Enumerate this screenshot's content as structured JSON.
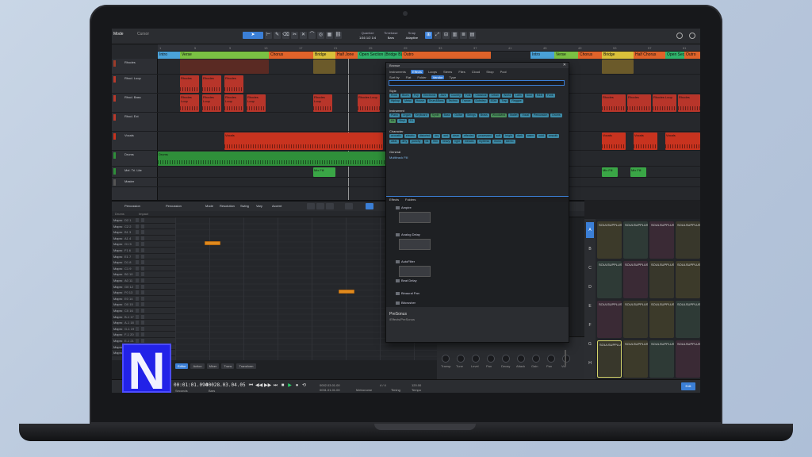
{
  "topbar": {
    "song": "Mode",
    "mode": "Cursor",
    "readouts": [
      {
        "label": "Quantize",
        "value": "1/16 1/2 1/4"
      },
      {
        "label": "Timebase",
        "value": "Bars"
      },
      {
        "label": "Snap",
        "value": "Adaptive"
      }
    ]
  },
  "ruler": [
    "1",
    "5",
    "9",
    "13",
    "17",
    "21",
    "25",
    "29",
    "33",
    "37",
    "41",
    "45",
    "49",
    "53",
    "57",
    "61"
  ],
  "markers": [
    {
      "label": "Intro",
      "color": "#4aa2d9"
    },
    {
      "label": "Verse",
      "color": "#7ac143"
    },
    {
      "label": "Chorus",
      "color": "#e0632a"
    },
    {
      "label": "Bridge",
      "color": "#d9c03a"
    },
    {
      "label": "Half Jone",
      "color": "#e0632a"
    },
    {
      "label": "Open Section (Bridge B)",
      "color": "#2fb36b"
    },
    {
      "label": "Outro",
      "color": "#e0632a"
    },
    {
      "label": "Intro",
      "color": "#4aa2d9"
    },
    {
      "label": "Verse",
      "color": "#7ac143"
    },
    {
      "label": "Chorus",
      "color": "#e0632a"
    },
    {
      "label": "Bridge",
      "color": "#d9c03a"
    },
    {
      "label": "Half Chorus",
      "color": "#e0632a"
    },
    {
      "label": "Open Sec. Ext",
      "color": "#2fb36b"
    },
    {
      "label": "Outro",
      "color": "#e0632a"
    }
  ],
  "tracks": [
    {
      "name": "Rhodes",
      "color": "#9b3b2a"
    },
    {
      "name": "Rhod. Loop",
      "color": "#b83a2c"
    },
    {
      "name": "Rhod. Bass",
      "color": "#b83a2c"
    },
    {
      "name": "Rhod. Ext",
      "color": "#b83a2c"
    },
    {
      "name": "Vocals",
      "color": "#c8331f"
    },
    {
      "name": "Drums",
      "color": "#2f8f3a"
    },
    {
      "name": "Mel. Tri. Lite",
      "color": "#2f8f3a"
    },
    {
      "name": "Master",
      "color": "#555"
    }
  ],
  "clip_labels": {
    "rhodes": "Rhodes",
    "rhodes_loop": "Rhodes Loop",
    "vocals": "Vocals",
    "drums": "Drums",
    "mix": "Mix Fill"
  },
  "editor": {
    "instrument": "Percussion",
    "preset": "Percussion",
    "controls": [
      "Mode",
      "Resolution",
      "Swing",
      "Vary",
      "Accent"
    ],
    "tabs": [
      "Editor",
      "Action",
      "Mixer",
      "Trans",
      "Transform"
    ],
    "sub_header": [
      "Drums",
      "Impact"
    ],
    "pitch_rows": [
      {
        "name": "Mapro",
        "pitch": "D2 1"
      },
      {
        "name": "Mapro",
        "pitch": "C2 2"
      },
      {
        "name": "Mapro",
        "pitch": "B1 3"
      },
      {
        "name": "Mapro",
        "pitch": "A1 4"
      },
      {
        "name": "Mapro",
        "pitch": "G1 5"
      },
      {
        "name": "Mapro",
        "pitch": "F1 6"
      },
      {
        "name": "Mapro",
        "pitch": "E1 7"
      },
      {
        "name": "Mapro",
        "pitch": "D1 8"
      },
      {
        "name": "Mapro",
        "pitch": "C1 9"
      },
      {
        "name": "Mapro",
        "pitch": "B0 10"
      },
      {
        "name": "Mapro",
        "pitch": "A0 11"
      },
      {
        "name": "Mapro",
        "pitch": "G0 12"
      },
      {
        "name": "Mapro",
        "pitch": "F0 13"
      },
      {
        "name": "Mapro",
        "pitch": "E0 14"
      },
      {
        "name": "Mapro",
        "pitch": "D0 15"
      },
      {
        "name": "Mapro",
        "pitch": "C0 16"
      },
      {
        "name": "Mapro",
        "pitch": "B-1 17"
      },
      {
        "name": "Mapro",
        "pitch": "A-1 18"
      },
      {
        "name": "Mapro",
        "pitch": "G-1 19"
      },
      {
        "name": "Mapro",
        "pitch": "F-1 20"
      },
      {
        "name": "Mapro",
        "pitch": "E-1 21"
      },
      {
        "name": "Mapro",
        "pitch": "D-1 22"
      },
      {
        "name": "Mapro",
        "pitch": "C-1 23"
      }
    ]
  },
  "browser": {
    "title": "Browse",
    "tabs": [
      "Instruments",
      "Effects",
      "Loops",
      "Stems",
      "Files",
      "Cloud",
      "Shop",
      "Pool"
    ],
    "filter_tabs": [
      "Sort by",
      "Flat",
      "Folder",
      "Vendor",
      "Type"
    ],
    "sections": {
      "style": "Style",
      "instrument": "Instrument",
      "character": "Character",
      "general": "General",
      "general_item": "Multitrack Fill"
    },
    "style_tags": [
      "Rock",
      "Blues",
      "Pop",
      "Electronic",
      "Jazz",
      "Country",
      "Folk",
      "Classical",
      "Urban",
      "World",
      "Latin",
      "Soul",
      "R&B",
      "Funk",
      "Hiphop",
      "Metal",
      "House",
      "Drum&Bass",
      "Techno",
      "Trance",
      "Dubstep",
      "EDM",
      "Trap",
      "Reggae"
    ],
    "instrument_tags": [
      "Piano",
      "Organ",
      "Keyboard",
      "Synth",
      "Bass",
      "Guitar",
      "Strings",
      "Brass",
      "Woodwind",
      "Mallet",
      "Vocal",
      "Percussion",
      "Drums",
      "Kit",
      "Vinyl",
      "FX"
    ],
    "character_tags": [
      "acoustic",
      "electric",
      "distorted",
      "dry",
      "wet",
      "clean",
      "effected",
      "processed",
      "soft",
      "bright",
      "dark",
      "warm",
      "cold",
      "smooth",
      "clear",
      "dirty",
      "punchy",
      "fat",
      "thin",
      "heavy",
      "light",
      "melodic",
      "rhythmic",
      "mono",
      "stereo"
    ],
    "list_tabs": [
      "Effects",
      "Folders"
    ],
    "effects": [
      "Ampire",
      "Analog Delay",
      "AutoFilter",
      "Beat Delay",
      "Binaural Pan",
      "Bitcrusher"
    ],
    "footer_name": "PreSonus",
    "footer_path": "/Effects/PreSonus"
  },
  "sampler": {
    "title": "SOULSUPPLUS_elevator_percuss_ui_hybrid_notes_hum_8_98bpm",
    "knobs": [
      "Transp.",
      "Tune",
      "Level",
      "Pan",
      "Decay",
      "Attack",
      "Gain",
      "Pan",
      "Vol"
    ]
  },
  "pads": {
    "letters": [
      "A",
      "B",
      "C",
      "D",
      "E",
      "F",
      "G",
      "H"
    ],
    "pad_label": "SOULSUPPLUS_88bpm"
  },
  "transport": {
    "position": "00:01:01.094",
    "bars": "00028.03.04.05",
    "loop_start": "0002.03.01.00",
    "loop_end": "0031.01.01.00",
    "signature": "4 / 4",
    "tempo": "120.00",
    "seconds": "Seconds",
    "bars_label": "Bars",
    "metronome": "Metronome",
    "timing": "Timing",
    "key": "Tempo",
    "edit_btn": "Edit"
  },
  "logo": "N"
}
